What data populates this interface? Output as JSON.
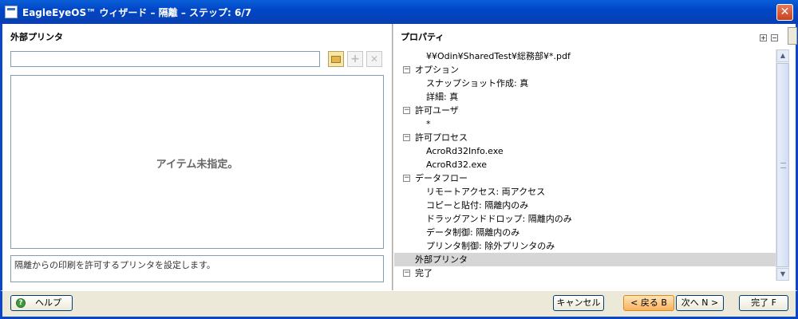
{
  "window": {
    "title": "EagleEyeOS™ ウィザード – 隔離 – ステップ: 6/7",
    "close_glyph": "✕"
  },
  "left": {
    "section_title": "外部プリンタ",
    "input_value": "",
    "empty_message": "アイテム未指定。",
    "description": "隔離からの印刷を許可するプリンタを設定します。",
    "tool_icons": [
      "folder-open-icon",
      "add-icon",
      "delete-icon"
    ]
  },
  "right": {
    "section_title": "プロパティ",
    "expand_glyph": "+",
    "collapse_glyph": "−",
    "tree": [
      {
        "text": "¥¥Odin¥SharedTest¥総務部¥*.pdf",
        "level": 1,
        "toggle": "",
        "selected": false
      },
      {
        "text": "オプション",
        "level": 0,
        "toggle": "−",
        "selected": false
      },
      {
        "text": "スナップショット作成: 真",
        "level": 1,
        "toggle": "",
        "selected": false
      },
      {
        "text": "詳細: 真",
        "level": 1,
        "toggle": "",
        "selected": false
      },
      {
        "text": "許可ユーザ",
        "level": 0,
        "toggle": "−",
        "selected": false
      },
      {
        "text": "*",
        "level": 1,
        "toggle": "",
        "selected": false
      },
      {
        "text": "許可プロセス",
        "level": 0,
        "toggle": "−",
        "selected": false
      },
      {
        "text": "AcroRd32Info.exe",
        "level": 1,
        "toggle": "",
        "selected": false
      },
      {
        "text": "AcroRd32.exe",
        "level": 1,
        "toggle": "",
        "selected": false
      },
      {
        "text": "データフロー",
        "level": 0,
        "toggle": "−",
        "selected": false
      },
      {
        "text": "リモートアクセス: 両アクセス",
        "level": 1,
        "toggle": "",
        "selected": false
      },
      {
        "text": "コピーと貼付: 隔離内のみ",
        "level": 1,
        "toggle": "",
        "selected": false
      },
      {
        "text": "ドラッグアンドドロップ: 隔離内のみ",
        "level": 1,
        "toggle": "",
        "selected": false
      },
      {
        "text": "データ制御: 隔離内のみ",
        "level": 1,
        "toggle": "",
        "selected": false
      },
      {
        "text": "プリンタ制御: 除外プリンタのみ",
        "level": 1,
        "toggle": "",
        "selected": false
      },
      {
        "text": "外部プリンタ",
        "level": 0,
        "toggle": "",
        "selected": true
      },
      {
        "text": "完了",
        "level": 0,
        "toggle": "−",
        "selected": false
      }
    ],
    "scroll_up_glyph": "▲",
    "scroll_down_glyph": "▼"
  },
  "buttons": {
    "help": "ヘルプ",
    "help_glyph": "?",
    "cancel": "キャンセル",
    "back": "< 戻る B",
    "next": "次へ N >",
    "finish": "完了 F"
  },
  "colors": {
    "title_bar": "#0a46c8",
    "selected_row": "#d6d6d6",
    "back_button": "#f9b25e"
  }
}
